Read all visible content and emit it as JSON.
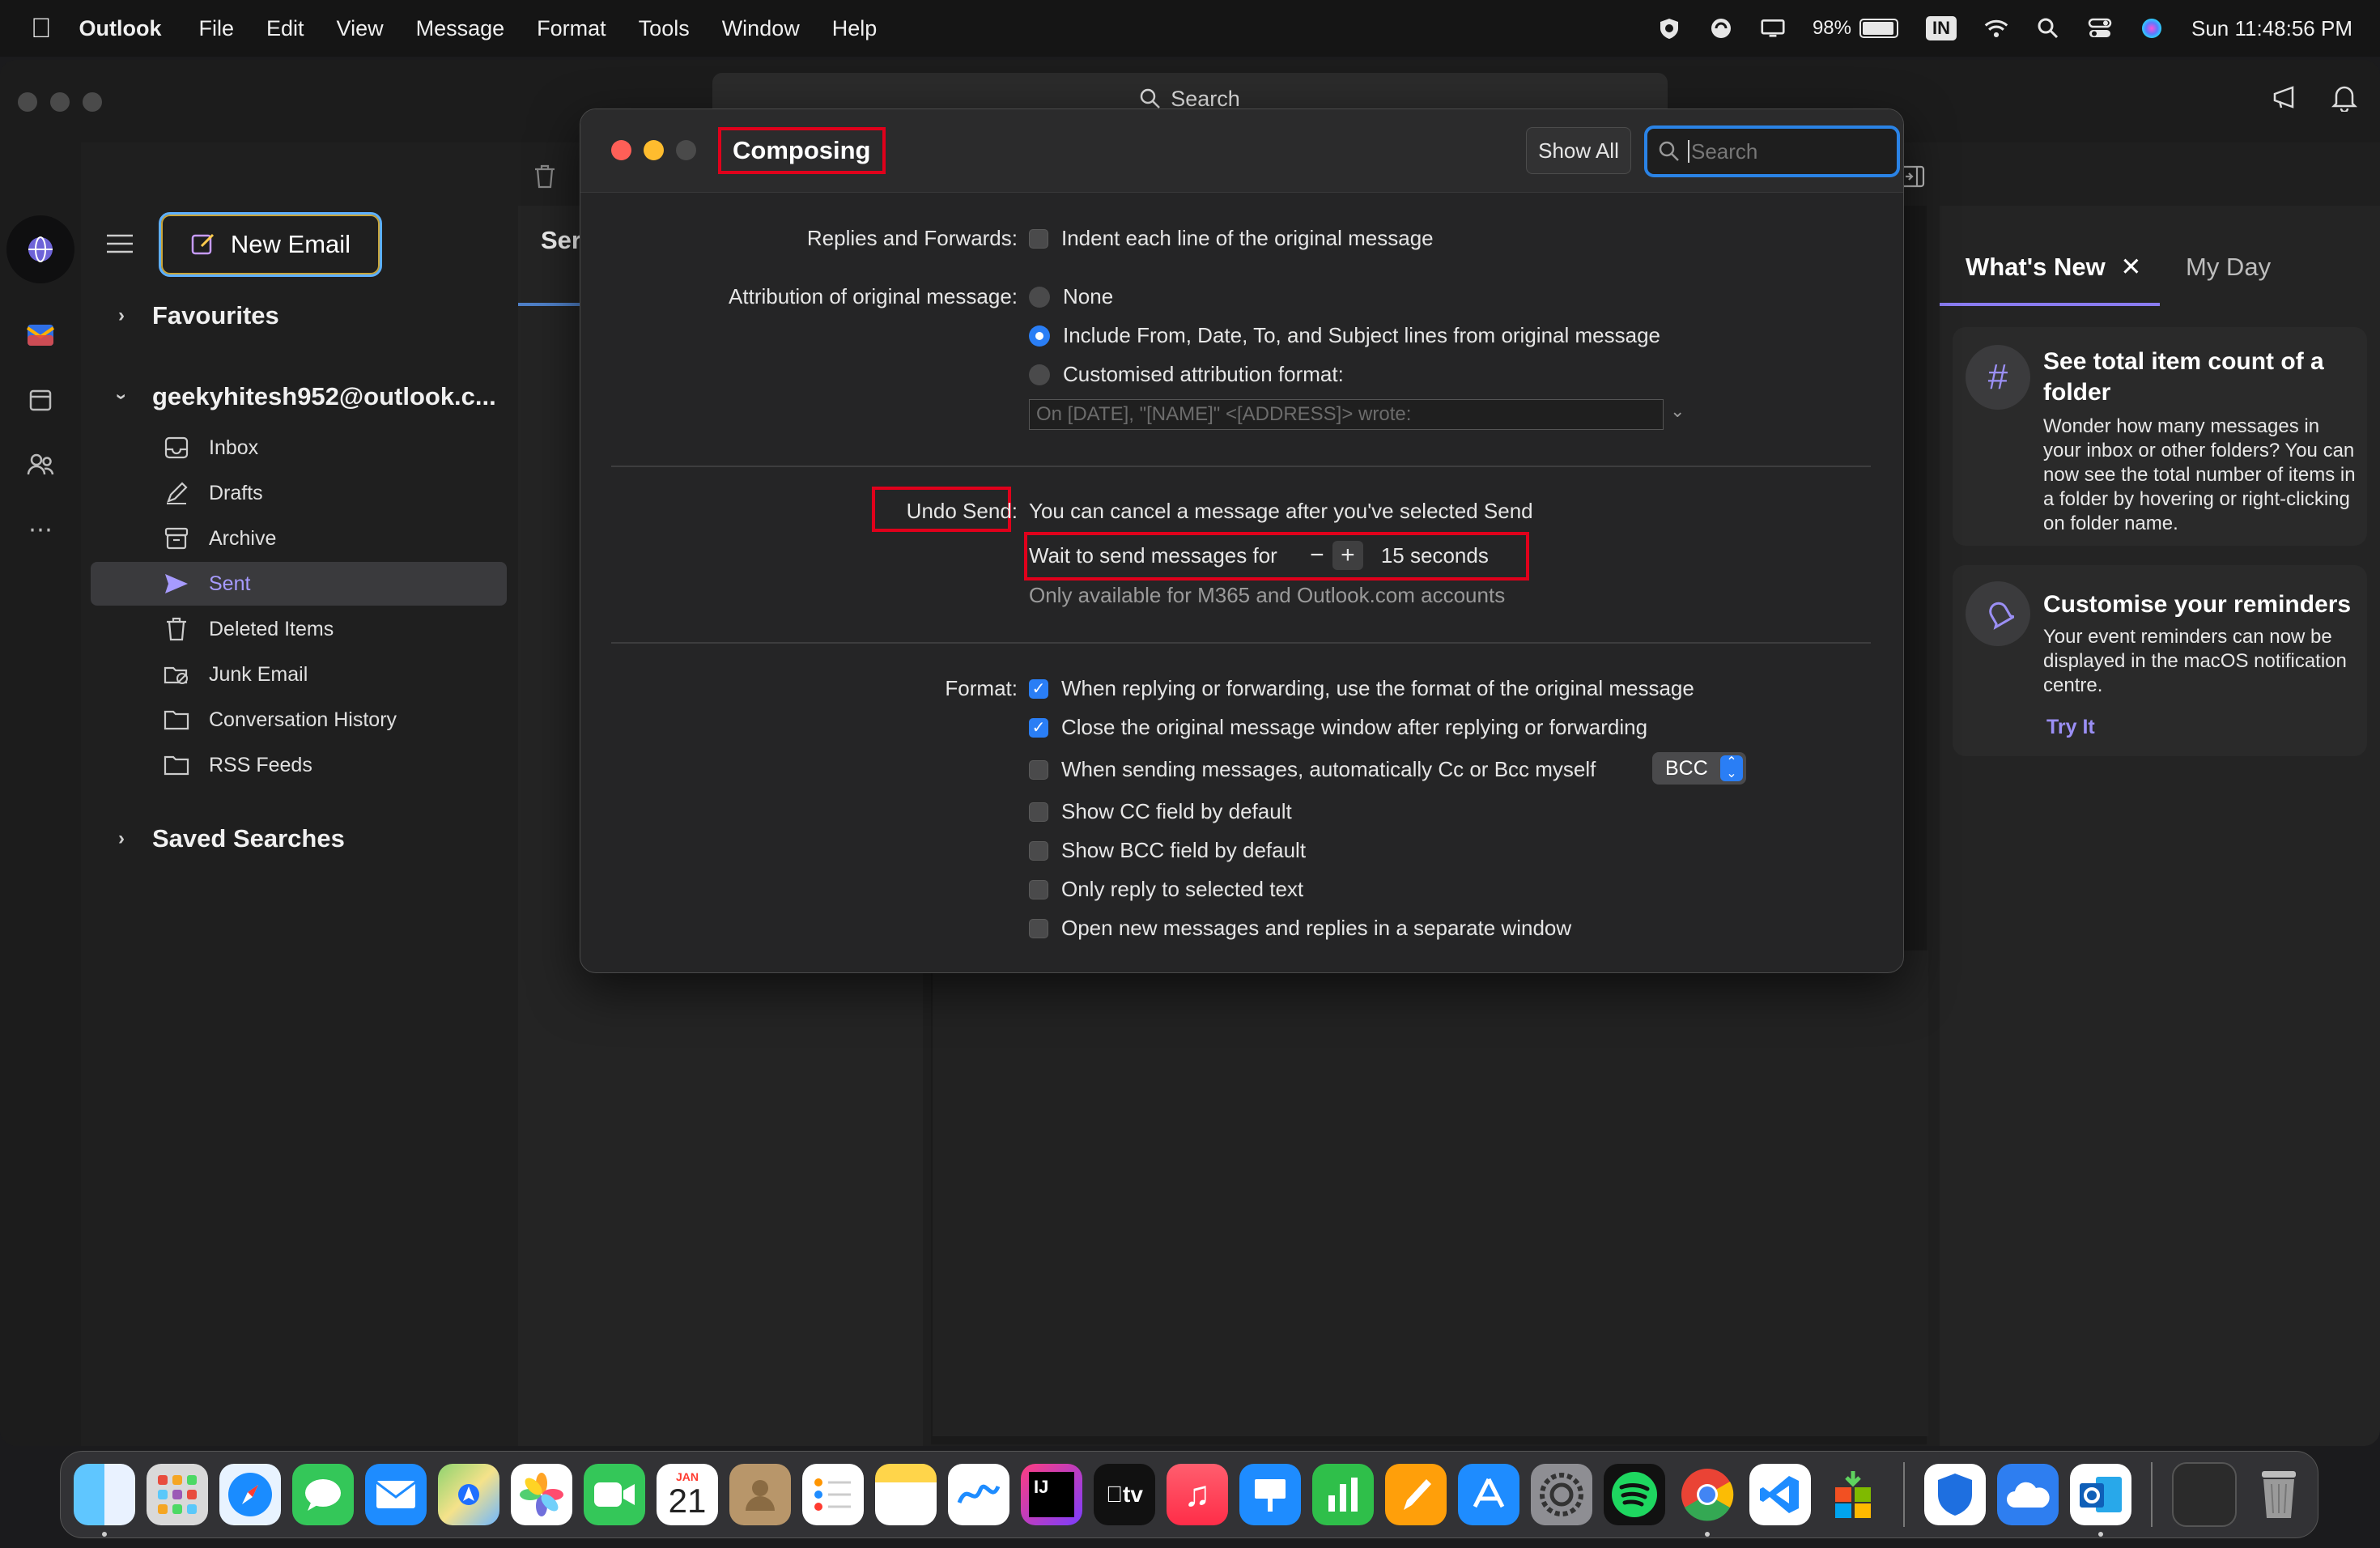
{
  "menubar": {
    "app_name": "Outlook",
    "items": [
      "File",
      "Edit",
      "View",
      "Message",
      "Format",
      "Tools",
      "Window",
      "Help"
    ],
    "battery": "98%",
    "input_source": "IN",
    "clock": "Sun 11:48:56 PM"
  },
  "window": {
    "search_label": "Search",
    "new_email_label": "New Email"
  },
  "folders": {
    "favourites_label": "Favourites",
    "account_label": "geekyhitesh952@outlook.c...",
    "items": [
      {
        "label": "Inbox",
        "icon": "inbox-icon"
      },
      {
        "label": "Drafts",
        "icon": "drafts-icon"
      },
      {
        "label": "Archive",
        "icon": "archive-icon"
      },
      {
        "label": "Sent",
        "icon": "sent-icon",
        "selected": true
      },
      {
        "label": "Deleted Items",
        "icon": "trash-icon"
      },
      {
        "label": "Junk Email",
        "icon": "junk-icon"
      },
      {
        "label": "Conversation History",
        "icon": "folder-icon"
      },
      {
        "label": "RSS Feeds",
        "icon": "folder-icon"
      }
    ],
    "saved_searches_label": "Saved Searches"
  },
  "message_list": {
    "tab_label": "Ser"
  },
  "right_pane": {
    "tab_whats_new": "What's New",
    "tab_my_day": "My Day",
    "cards": [
      {
        "title": "See total item count of a folder",
        "body": "Wonder how many messages in your inbox or other folders? You can now see the total number of items in a folder by hovering or right-clicking on folder name."
      },
      {
        "title": "Customise your reminders",
        "body": "Your event reminders can now be displayed in the macOS notification centre.",
        "link": "Try It"
      }
    ]
  },
  "dialog": {
    "title": "Composing",
    "show_all_label": "Show All",
    "search_placeholder": "Search",
    "replies_label": "Replies and Forwards:",
    "indent_option": "Indent each line of the original message",
    "attribution_label": "Attribution of original message:",
    "attribution_options": [
      {
        "label": "None",
        "checked": false
      },
      {
        "label": "Include From, Date, To, and Subject lines from original message",
        "checked": true
      },
      {
        "label": "Customised attribution format:",
        "checked": false
      }
    ],
    "attribution_format_value": "On [DATE], \"[NAME]\" <[ADDRESS]> wrote:",
    "undo_send_label": "Undo Send:",
    "undo_send_desc": "You can cancel a message after you've selected Send",
    "wait_label": "Wait to send messages for",
    "wait_value": "15 seconds",
    "availability_note": "Only available for M365 and Outlook.com accounts",
    "format_label": "Format:",
    "format_options": [
      {
        "label": "When replying or forwarding, use the format of the original message",
        "checked": true
      },
      {
        "label": "Close the original message window after replying or forwarding",
        "checked": true
      },
      {
        "label": "When sending messages, automatically Cc or Bcc myself",
        "checked": false
      },
      {
        "label": "Show CC field by default",
        "checked": false
      },
      {
        "label": "Show BCC field by default",
        "checked": false
      },
      {
        "label": "Only reply to selected text",
        "checked": false
      },
      {
        "label": "Open new messages and replies in a separate window",
        "checked": false
      }
    ],
    "bcc_select_value": "BCC"
  },
  "dock": {
    "calendar_month": "JAN",
    "calendar_day": "21",
    "apps": [
      "Finder",
      "Launchpad",
      "Safari",
      "Messages",
      "Mail",
      "Maps",
      "Photos",
      "FaceTime",
      "Calendar",
      "Contacts",
      "Reminders",
      "Notes",
      "Freeform",
      "IntelliJ IDEA",
      "TV",
      "Music",
      "Keynote",
      "Numbers",
      "Pages",
      "App Store",
      "System Settings",
      "Spotify",
      "Chrome",
      "VS Code",
      "Microsoft Store",
      "Defender",
      "OneDrive",
      "Outlook",
      "Screenshot",
      "Trash"
    ]
  },
  "colors": {
    "accent_blue": "#2a7ef5",
    "highlight_red": "#e0001b",
    "outlook_purple": "#8a7cf0"
  }
}
